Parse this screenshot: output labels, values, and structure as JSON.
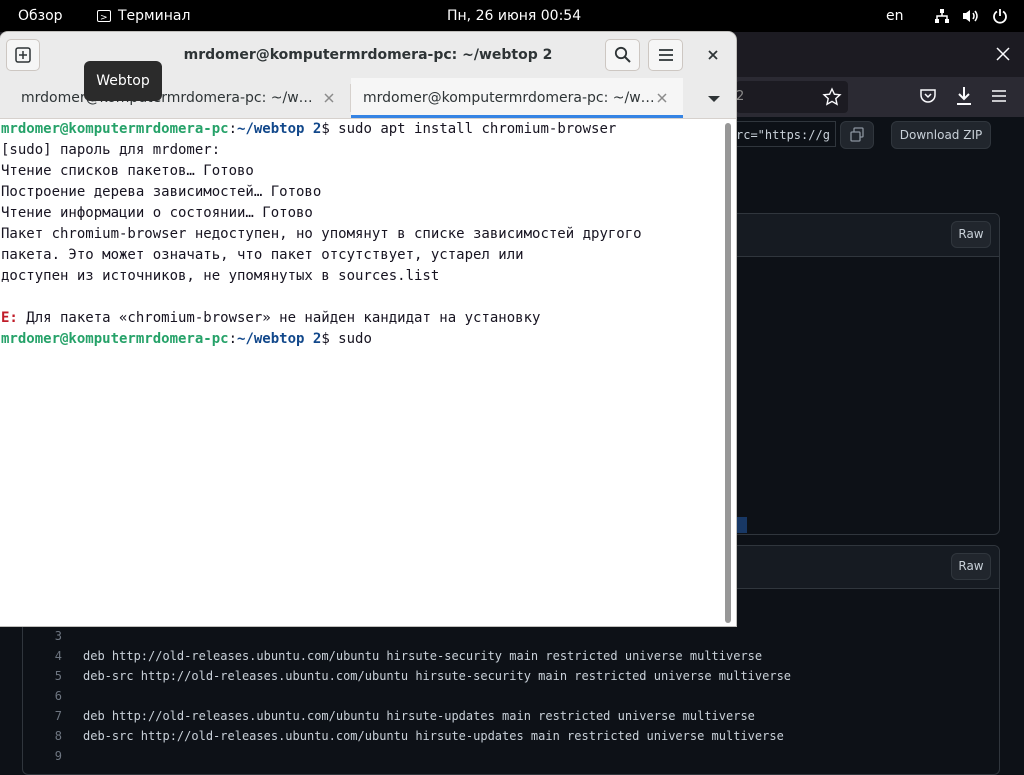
{
  "topbar": {
    "overview": "Обзор",
    "app_name": "Терминал",
    "clock": "Пн, 26 июня  00:54",
    "keyboard_layout": "en",
    "icons": [
      "network-icon",
      "volume-icon",
      "power-icon"
    ]
  },
  "browser": {
    "url_fragment": "2",
    "embed_code": "rc=\"https://g",
    "download_zip_label": "Download ZIP",
    "raw_label": "Raw",
    "raw_label_2": "Raw",
    "file_lines": [
      {
        "num": "3",
        "text": ""
      },
      {
        "num": "4",
        "text": "deb http://old-releases.ubuntu.com/ubuntu hirsute-security main restricted universe multiverse"
      },
      {
        "num": "5",
        "text": "deb-src http://old-releases.ubuntu.com/ubuntu hirsute-security main restricted universe multiverse"
      },
      {
        "num": "6",
        "text": ""
      },
      {
        "num": "7",
        "text": "deb http://old-releases.ubuntu.com/ubuntu hirsute-updates main restricted universe multiverse"
      },
      {
        "num": "8",
        "text": "deb-src http://old-releases.ubuntu.com/ubuntu hirsute-updates main restricted universe multiverse"
      },
      {
        "num": "9",
        "text": ""
      }
    ],
    "colors": {
      "background": "#0d1117",
      "toolbar": "#2b2a33",
      "border": "#30363d"
    }
  },
  "terminal": {
    "title": "mrdomer@komputermrdomera-pc: ~/webtop 2",
    "tooltip": "Webtop",
    "tabs": [
      {
        "label": "mrdomer@komputermrdomera-pc: ~/w…",
        "active": false
      },
      {
        "label": "mrdomer@komputermrdomera-pc: ~/w…",
        "active": true
      }
    ],
    "prompt_user": "mrdomer@komputermrdomera-pc",
    "prompt_colon": ":",
    "prompt_path": "~/webtop 2",
    "prompt_dollar": "$ ",
    "command1": "sudo apt install chromium-browser",
    "output": [
      "[sudo] пароль для mrdomer:",
      "Чтение списков пакетов… Готово",
      "Построение дерева зависимостей… Готово",
      "Чтение информации о состоянии… Готово",
      "Пакет chromium-browser недоступен, но упомянут в списке зависимостей другого",
      "пакета. Это может означать, что пакет отсутствует, устарел или",
      "доступен из источников, не упомянутых в sources.list"
    ],
    "error_prefix": "E:",
    "error_text": " Для пакета «chromium-browser» не найден кандидат на установку",
    "command2": "sudo",
    "colors": {
      "user": "#26a269",
      "path": "#12488b",
      "error": "#c01c28",
      "active_tab": "#3584e4"
    }
  }
}
